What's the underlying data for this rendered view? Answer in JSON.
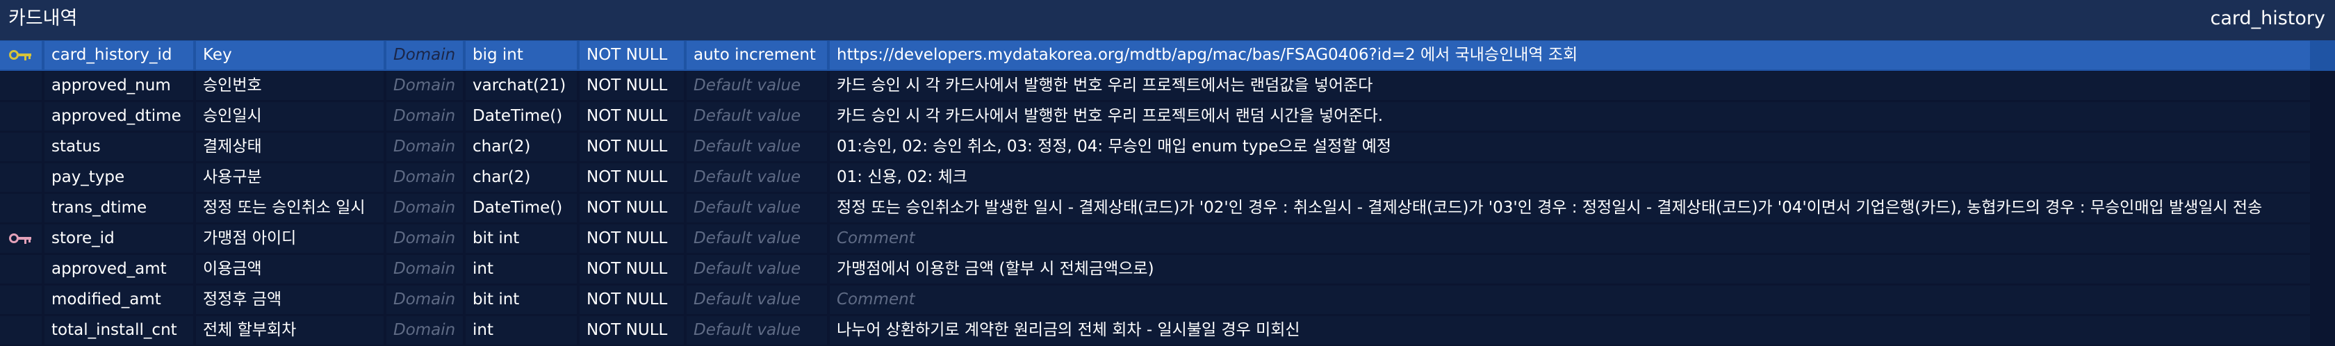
{
  "entity": {
    "logical_name": "카드내역",
    "physical_name": "card_history"
  },
  "placeholders": {
    "domain": "Domain",
    "default": "Default value",
    "comment": "Comment"
  },
  "icons": {
    "primary_key": "key-icon",
    "foreign_key": "key-icon"
  },
  "colors": {
    "background": "#1b2f55",
    "selected_row": "#2a62b8",
    "primary_key_icon": "#d6c33a",
    "foreign_key_icon": "#e3a1b9",
    "placeholder_text": "#5f6b85"
  },
  "columns": [
    {
      "name": "card_history_id",
      "logical": "Key",
      "domain": "Domain",
      "type": "big int",
      "nullability": "NOT NULL",
      "default": "auto increment",
      "comment": "https://developers.mydatakorea.org/mdtb/apg/mac/bas/FSAG0406?id=2 에서 국내승인내역 조회"
    },
    {
      "name": "approved_num",
      "logical": "승인번호",
      "domain": "Domain",
      "type": "varchat(21)",
      "nullability": "NOT NULL",
      "default": "Default value",
      "comment": "카드 승인 시 각 카드사에서 발행한 번호 우리 프로젝트에서는 랜덤값을 넣어준다"
    },
    {
      "name": "approved_dtime",
      "logical": "승인일시",
      "domain": "Domain",
      "type": "DateTime()",
      "nullability": "NOT NULL",
      "default": "Default value",
      "comment": "카드 승인 시 각 카드사에서 발행한 번호 우리 프로젝트에서 랜덤 시간을 넣어준다."
    },
    {
      "name": "status",
      "logical": "결제상태",
      "domain": "Domain",
      "type": "char(2)",
      "nullability": "NOT NULL",
      "default": "Default value",
      "comment": "01:승인, 02: 승인 취소, 03: 정정, 04: 무승인 매입 enum type으로 설정할 예정"
    },
    {
      "name": "pay_type",
      "logical": "사용구분",
      "domain": "Domain",
      "type": "char(2)",
      "nullability": "NOT NULL",
      "default": "Default value",
      "comment": "01: 신용, 02: 체크"
    },
    {
      "name": "trans_dtime",
      "logical": "정정 또는 승인취소 일시",
      "domain": "Domain",
      "type": "DateTime()",
      "nullability": "NOT NULL",
      "default": "Default value",
      "comment": "정정 또는 승인취소가 발생한 일시 - 결제상태(코드)가 '02'인 경우 : 취소일시 - 결제상태(코드)가 '03'인 경우 : 정정일시 - 결제상태(코드)가 '04'이면서 기업은행(카드), 농협카드의 경우 : 무승인매입 발생일시 전송"
    },
    {
      "name": "store_id",
      "logical": "가맹점 아이디",
      "domain": "Domain",
      "type": "bit int",
      "nullability": "NOT NULL",
      "default": "Default value",
      "comment": "Comment"
    },
    {
      "name": "approved_amt",
      "logical": "이용금액",
      "domain": "Domain",
      "type": "int",
      "nullability": "NOT NULL",
      "default": "Default value",
      "comment": "가맹점에서 이용한 금액 (할부 시 전체금액으로)"
    },
    {
      "name": "modified_amt",
      "logical": "정정후 금액",
      "domain": "Domain",
      "type": "bit int",
      "nullability": "NOT NULL",
      "default": "Default value",
      "comment": "Comment"
    },
    {
      "name": "total_install_cnt",
      "logical": "전체 할부회차",
      "domain": "Domain",
      "type": "int",
      "nullability": "NOT NULL",
      "default": "Default value",
      "comment": "나누어 상환하기로 계약한 원리금의 전체 회차 - 일시불일 경우 미회신"
    }
  ]
}
